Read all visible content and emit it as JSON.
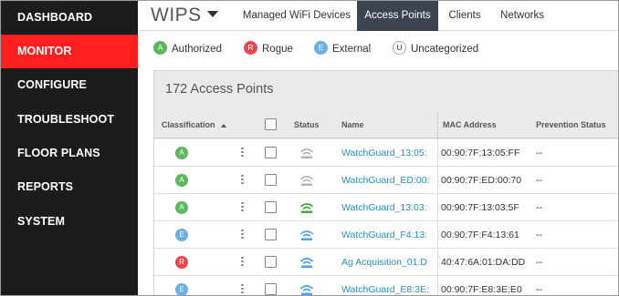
{
  "sidebar": {
    "items": [
      {
        "label": "DASHBOARD",
        "active": false
      },
      {
        "label": "MONITOR",
        "active": true
      },
      {
        "label": "CONFIGURE",
        "active": false
      },
      {
        "label": "TROUBLESHOOT",
        "active": false
      },
      {
        "label": "FLOOR PLANS",
        "active": false
      },
      {
        "label": "REPORTS",
        "active": false
      },
      {
        "label": "SYSTEM",
        "active": false
      }
    ]
  },
  "header": {
    "brand": "WIPS",
    "tabs": [
      {
        "label": "Managed WiFi Devices",
        "active": false
      },
      {
        "label": "Access Points",
        "active": true
      },
      {
        "label": "Clients",
        "active": false
      },
      {
        "label": "Networks",
        "active": false
      }
    ]
  },
  "legend": [
    {
      "letter": "A",
      "label": "Authorized",
      "kind": "authorized",
      "color": "#5cb85c"
    },
    {
      "letter": "R",
      "label": "Rogue",
      "kind": "rogue",
      "color": "#e8474f"
    },
    {
      "letter": "E",
      "label": "External",
      "kind": "external",
      "color": "#6aaee6"
    },
    {
      "letter": "U",
      "label": "Uncategorized",
      "kind": "uncategorized",
      "color": "#ffffff"
    }
  ],
  "panel": {
    "title": "172 Access Points",
    "columns": {
      "classification": "Classification",
      "status": "Status",
      "name": "Name",
      "mac": "MAC Address",
      "prevention": "Prevention Status"
    }
  },
  "rows": [
    {
      "class_letter": "A",
      "class_kind": "authorized",
      "status_icon": "wifi-grey-icon",
      "name": "WatchGuard_13:05:",
      "mac": "00:90:7F:13:05:FF",
      "prevention": "--"
    },
    {
      "class_letter": "A",
      "class_kind": "authorized",
      "status_icon": "wifi-grey-icon",
      "name": "WatchGuard_ED:00:",
      "mac": "00:90:7F:ED:00:70",
      "prevention": "--"
    },
    {
      "class_letter": "A",
      "class_kind": "authorized",
      "status_icon": "wifi-green-icon",
      "name": "WatchGuard_13:03:",
      "mac": "00:90:7F:13:03:5F",
      "prevention": "--"
    },
    {
      "class_letter": "E",
      "class_kind": "external",
      "status_icon": "wifi-blue-icon",
      "name": "WatchGuard_F4:13:",
      "mac": "00:90:7F:F4:13:61",
      "prevention": "--"
    },
    {
      "class_letter": "R",
      "class_kind": "rogue",
      "status_icon": "wifi-blue-icon",
      "name": "Ag Acquisition_01:D",
      "mac": "40:47:6A:01:DA:DD",
      "prevention": "--"
    },
    {
      "class_letter": "E",
      "class_kind": "external",
      "status_icon": "wifi-blue-icon",
      "name": "WatchGuard_E8:3E:",
      "mac": "00:90:7F:E8:3E:E0",
      "prevention": "--"
    }
  ],
  "icon_colors": {
    "wifi-grey-icon": "#b5b5b5",
    "wifi-green-icon": "#3fa83f",
    "wifi-blue-icon": "#4aa6dc"
  }
}
